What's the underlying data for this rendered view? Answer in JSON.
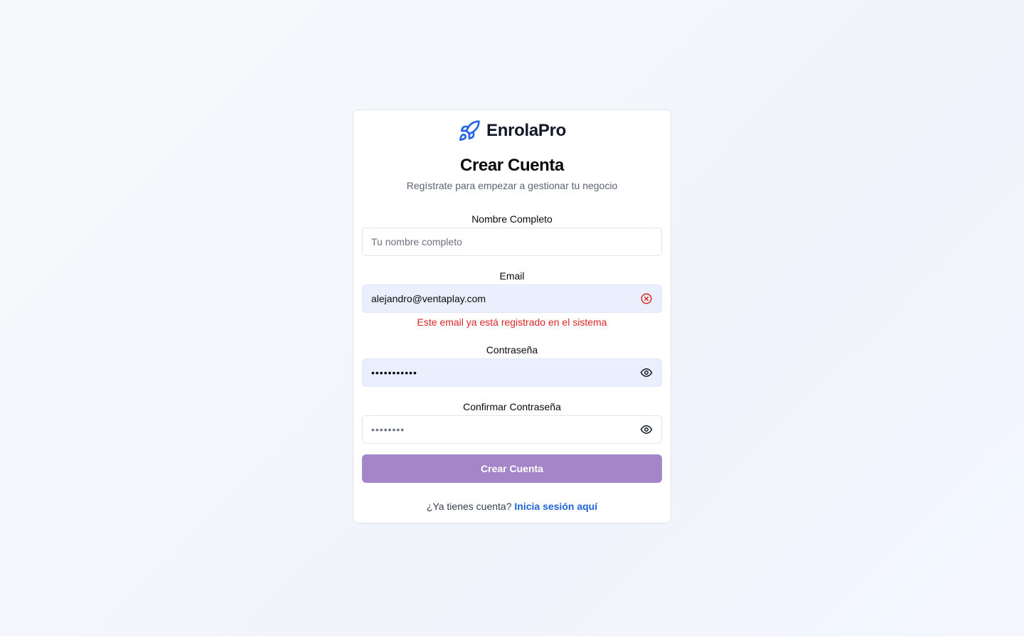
{
  "brand": {
    "name": "EnrolaPro",
    "icon": "rocket-icon",
    "icon_color": "#2563eb"
  },
  "page": {
    "title": "Crear Cuenta",
    "subtitle": "Regístrate para empezar a gestionar tu negocio"
  },
  "form": {
    "full_name": {
      "label": "Nombre Completo",
      "placeholder": "Tu nombre completo",
      "value": ""
    },
    "email": {
      "label": "Email",
      "value": "alejandro@ventaplay.com",
      "status_icon": "error-circle-icon",
      "error": "Este email ya está registrado en el sistema"
    },
    "password": {
      "label": "Contraseña",
      "masked_value": "•••••••••••",
      "toggle_icon": "eye-icon"
    },
    "confirm_password": {
      "label": "Confirmar Contraseña",
      "masked_value": "••••••••",
      "toggle_icon": "eye-icon"
    },
    "submit_label": "Crear Cuenta"
  },
  "footer": {
    "prompt": "¿Ya tienes cuenta?",
    "link_label": "Inicia sesión aquí"
  },
  "colors": {
    "accent": "#a385c8",
    "error": "#dc2626",
    "link": "#1d64d8",
    "autofill_bg": "#e9effd"
  }
}
